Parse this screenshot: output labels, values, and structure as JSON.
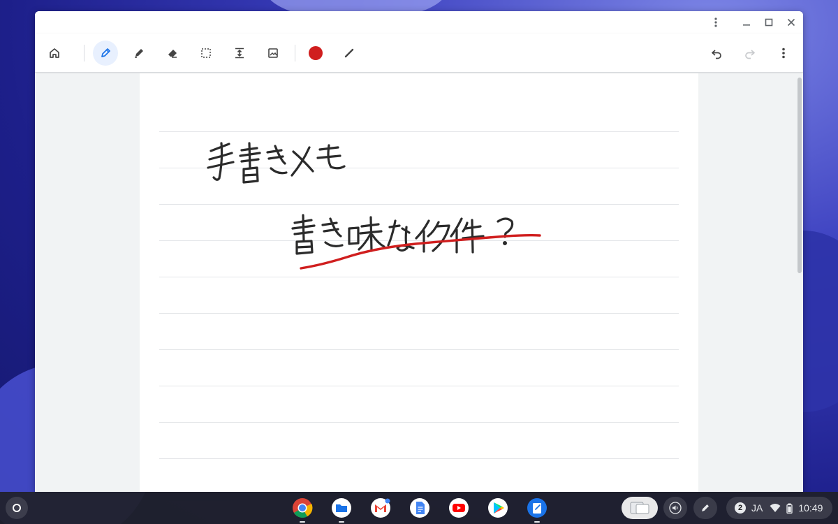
{
  "window": {
    "controls": {
      "menu_icon": "more-vert-icon",
      "minimize_icon": "minimize-icon",
      "maximize_icon": "maximize-icon",
      "close_icon": "close-icon"
    }
  },
  "toolbar": {
    "left_tools": [
      {
        "name": "home",
        "icon": "home-icon"
      },
      {
        "name": "pen",
        "icon": "pen-icon",
        "active": true
      },
      {
        "name": "highlighter",
        "icon": "highlighter-icon"
      },
      {
        "name": "eraser",
        "icon": "eraser-icon"
      },
      {
        "name": "select",
        "icon": "lasso-select-icon"
      },
      {
        "name": "insert-space",
        "icon": "insert-space-icon"
      },
      {
        "name": "image",
        "icon": "image-icon"
      }
    ],
    "pen_color": "#d01e1e",
    "stroke_icon": "stroke-width-icon",
    "right_tools": [
      {
        "name": "undo",
        "icon": "undo-icon"
      },
      {
        "name": "redo",
        "icon": "redo-icon",
        "disabled": true
      },
      {
        "name": "more",
        "icon": "more-vert-icon"
      }
    ]
  },
  "canvas": {
    "ink_color_primary": "#2b2b2b",
    "ink_color_accent": "#d01e1e"
  },
  "shelf": {
    "apps": [
      {
        "name": "chrome",
        "icon": "chrome-icon"
      },
      {
        "name": "files",
        "icon": "files-icon"
      },
      {
        "name": "gmail",
        "icon": "gmail-icon"
      },
      {
        "name": "docs",
        "icon": "docs-icon"
      },
      {
        "name": "youtube",
        "icon": "youtube-icon"
      },
      {
        "name": "play-store",
        "icon": "play-store-icon"
      },
      {
        "name": "cursive",
        "icon": "cursive-icon"
      }
    ],
    "tray": {
      "notification_count": "2",
      "ime": "JA",
      "time": "10:49"
    }
  }
}
